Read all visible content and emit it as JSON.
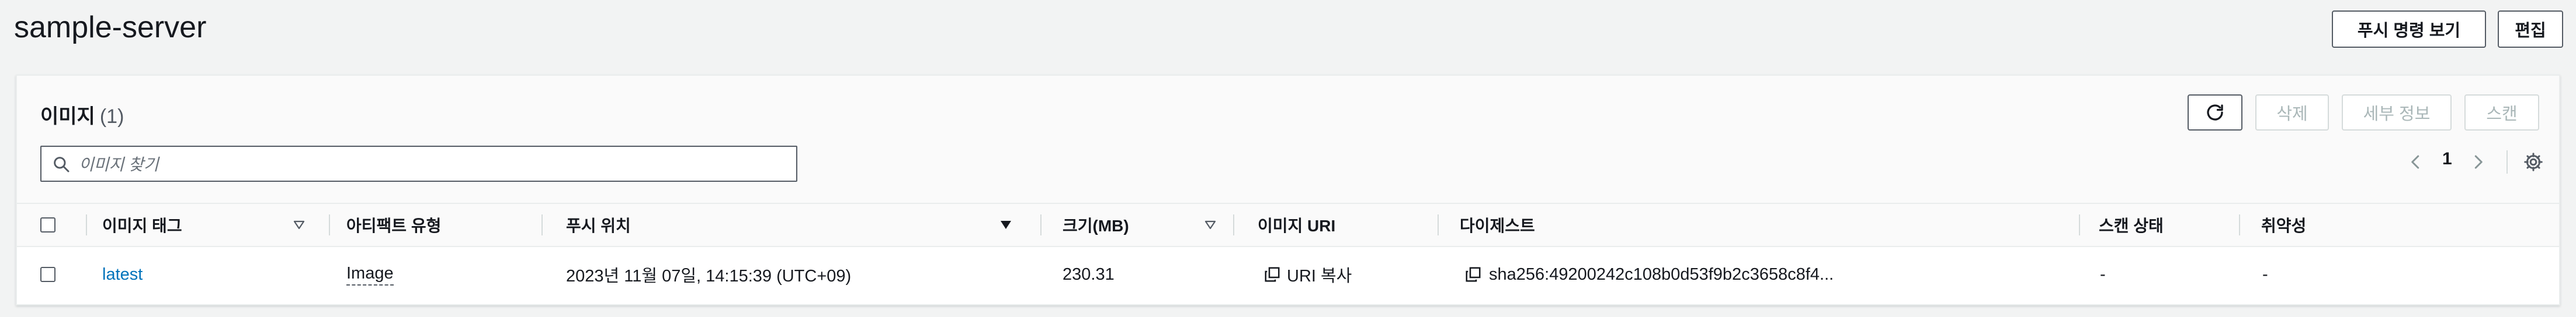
{
  "page": {
    "title": "sample-server",
    "push_commands_label": "푸시 명령 보기",
    "edit_label": "편집"
  },
  "images_panel": {
    "title": "이미지",
    "count": "(1)",
    "delete_label": "삭제",
    "details_label": "세부 정보",
    "scan_label": "스캔",
    "search_placeholder": "이미지 찾기",
    "page_number": "1",
    "icons": {
      "refresh": "refresh-icon",
      "search": "search-icon",
      "prev": "chevron-left-icon",
      "next": "chevron-right-icon",
      "settings": "gear-icon",
      "copy": "copy-icon"
    }
  },
  "table": {
    "columns": [
      "이미지 태그",
      "아티팩트 유형",
      "푸시 위치",
      "크기(MB)",
      "이미지 URI",
      "다이제스트",
      "스캔 상태",
      "취약성"
    ],
    "sorted_column": "푸시 위치",
    "rows": [
      {
        "tag": "latest",
        "artifact_type": "Image",
        "pushed_at": "2023년 11월 07일, 14:15:39 (UTC+09)",
        "size": "230.31",
        "uri_label": "URI 복사",
        "digest": "sha256:49200242c108b0d53f9b2c3658c8f4...",
        "scan_status": "-",
        "vulnerabilities": "-"
      }
    ]
  },
  "colors": {
    "link": "#0073bb",
    "background": "#f2f3f3",
    "border": "#545b64",
    "disabled": "#aab7b8"
  }
}
